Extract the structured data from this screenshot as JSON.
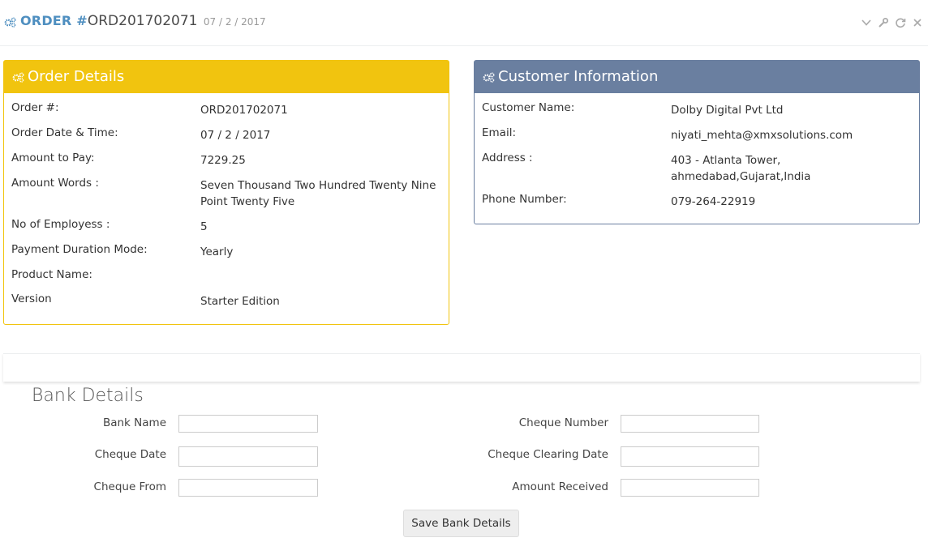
{
  "header": {
    "label": "ORDER #",
    "order_number": "ORD201702071",
    "date": "07 / 2 / 2017",
    "icon": "cogs-icon",
    "tools": [
      "chevron-down-icon",
      "wrench-icon",
      "refresh-icon",
      "close-icon"
    ]
  },
  "order_details": {
    "title": "Order Details",
    "rows": [
      {
        "label": "Order #:",
        "value": "ORD201702071"
      },
      {
        "label": "Order Date & Time:",
        "value": "07 / 2 / 2017"
      },
      {
        "label": "Amount to Pay:",
        "value": "7229.25"
      },
      {
        "label": "Amount Words :",
        "value": "Seven Thousand Two Hundred Twenty Nine Point Twenty Five"
      },
      {
        "label": "No of Employess :",
        "value": "5"
      },
      {
        "label": "Payment Duration Mode:",
        "value": "Yearly"
      },
      {
        "label": "Product Name:",
        "value": ""
      },
      {
        "label": "Version",
        "value": "Starter Edition"
      }
    ]
  },
  "customer_info": {
    "title": "Customer Information",
    "rows": [
      {
        "label": "Customer Name:",
        "value": "Dolby Digital Pvt Ltd"
      },
      {
        "label": "Email:",
        "value": "niyati_mehta@xmxsolutions.com"
      },
      {
        "label": "Address :",
        "value": "403 - Atlanta Tower, ahmedabad,Gujarat,India"
      },
      {
        "label": "Phone Number:",
        "value": "079-264-22919"
      }
    ]
  },
  "bank_details": {
    "title": "Bank Details",
    "fields": {
      "bank_name": {
        "label": "Bank Name",
        "value": ""
      },
      "cheque_number": {
        "label": "Cheque Number",
        "value": ""
      },
      "cheque_date": {
        "label": "Cheque Date",
        "value": ""
      },
      "cheque_clearing_date": {
        "label": "Cheque Clearing Date",
        "value": ""
      },
      "cheque_from": {
        "label": "Cheque From",
        "value": ""
      },
      "amount_received": {
        "label": "Amount Received",
        "value": ""
      }
    },
    "save_label": "Save Bank Details"
  },
  "colors": {
    "order_header": "#f1c40f",
    "customer_header": "#6a7fa0",
    "title_accent": "#4f8fc0"
  }
}
